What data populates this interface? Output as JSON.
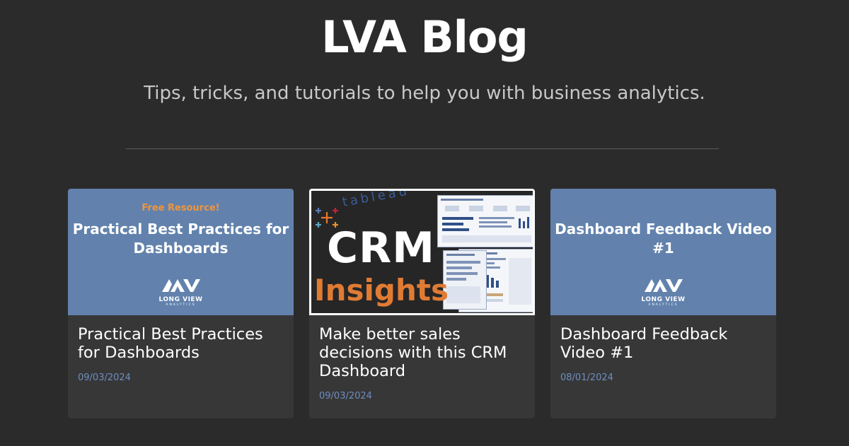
{
  "header": {
    "title": "LVA Blog",
    "subtitle": "Tips, tricks, and tutorials to help you with business analytics."
  },
  "cards": [
    {
      "title": "Practical Best Practices for Dashboards",
      "date": "09/03/2024",
      "thumb": {
        "kicker": "Free Resource!",
        "headline": "Practical Best Practices for Dashboards",
        "logo_text": "LONG VIEW",
        "logo_sub": "ANALYTICS",
        "bg": "#6282ad"
      }
    },
    {
      "title": "Make better sales decisions with this CRM Dashboard",
      "date": "09/03/2024",
      "thumb": {
        "brand": "tableau",
        "big": "CRM",
        "accent": "Insights",
        "accent_color": "#e07b34"
      }
    },
    {
      "title": "Dashboard Feedback Video #1",
      "date": "08/01/2024",
      "thumb": {
        "headline": "Dashboard Feedback Video #1",
        "logo_text": "LONG VIEW",
        "logo_sub": "ANALYTICS",
        "bg": "#6282ad"
      }
    }
  ],
  "colors": {
    "background": "#2b2b2b",
    "card": "#373737",
    "date": "#6f8dc0",
    "thumb_blue": "#6282ad"
  },
  "icons": [
    "lva-logo-icon",
    "tableau-logo-icon"
  ]
}
